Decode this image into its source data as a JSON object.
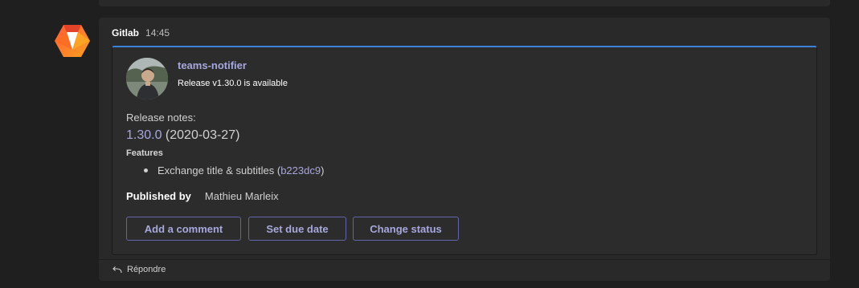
{
  "message": {
    "sender": "Gitlab",
    "time": "14:45",
    "sender_icon": "gitlab-logo-icon"
  },
  "card": {
    "app_name": "teams-notifier",
    "subtitle": "Release v1.30.0 is available",
    "avatar_icon": "user-avatar-photo",
    "release_notes_label": "Release notes:",
    "version_link": "1.30.0",
    "version_date": " (2020-03-27)",
    "features_label": "Features",
    "feature_items": [
      {
        "text": "Exchange title & subtitles (",
        "link": "b223dc9",
        "suffix": ")"
      }
    ],
    "published_by_label": "Published by",
    "published_by_value": "Mathieu Marleix"
  },
  "actions": {
    "add_comment": "Add a comment",
    "set_due_date": "Set due date",
    "change_status": "Change status"
  },
  "reply": {
    "label": "Répondre",
    "icon": "reply-arrow-icon"
  },
  "colors": {
    "background": "#1f1f1f",
    "message_bg": "#292929",
    "card_bg": "#2d2c2c",
    "accent_link": "#a6a7dc",
    "button_border": "#6264a7",
    "card_top_border": "#3c82d8"
  }
}
